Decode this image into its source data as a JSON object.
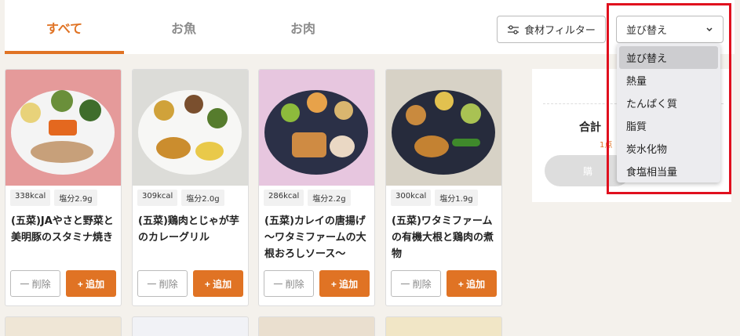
{
  "tabs": [
    {
      "label": "すべて",
      "active": true
    },
    {
      "label": "お魚",
      "active": false
    },
    {
      "label": "お肉",
      "active": false
    }
  ],
  "filter": {
    "label": "食材フィルター",
    "icon": "sliders-icon"
  },
  "sort": {
    "selected": "並び替え",
    "options": [
      "並び替え",
      "熱量",
      "たんぱく質",
      "脂質",
      "炭水化物",
      "食塩相当量"
    ]
  },
  "products": [
    {
      "kcal": "338kcal",
      "salt": "塩分2.9g",
      "name": "(五菜)JAやさと野菜と美明豚のスタミナ焼き"
    },
    {
      "kcal": "309kcal",
      "salt": "塩分2.0g",
      "name": "(五菜)鶏肉とじゃが芋のカレーグリル"
    },
    {
      "kcal": "286kcal",
      "salt": "塩分2.2g",
      "name": "(五菜)カレイの唐揚げ～ワタミファームの大根おろしソース～"
    },
    {
      "kcal": "300kcal",
      "salt": "塩分1.9g",
      "name": "(五菜)ワタミファームの有機大根と鶏肉の煮物"
    }
  ],
  "buttons": {
    "remove": "一 削除",
    "add": "+ 追加"
  },
  "summary": {
    "total_label": "合計",
    "count_label": "1点",
    "buy_label": "購"
  },
  "colors": {
    "accent": "#e07324",
    "highlight": "#e0101e"
  }
}
